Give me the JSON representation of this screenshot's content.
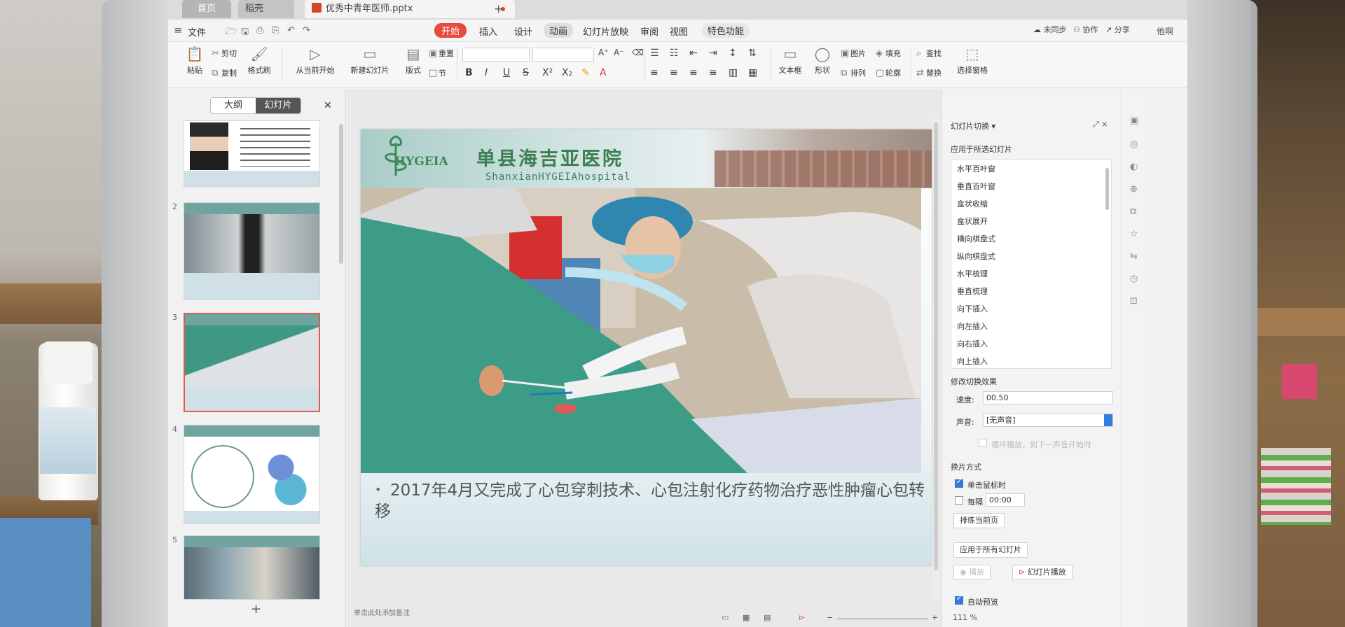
{
  "tabs": {
    "home": "首页",
    "shell": "稻壳",
    "file": "优秀中青年医师.pptx"
  },
  "menu": {
    "file": "文件",
    "items": [
      "开始",
      "插入",
      "设计",
      "动画",
      "幻灯片放映",
      "审阅",
      "视图",
      "特色功能"
    ],
    "user": "他啊"
  },
  "ribbon": {
    "paste": "粘贴",
    "cut": "剪切",
    "copy": "复制",
    "format_painter": "格式刷",
    "from_current": "从当前开始",
    "new_slide": "新建幻灯片",
    "layout": "版式",
    "reset": "重置",
    "section": "节",
    "text_box": "文本框",
    "shape": "形状",
    "picture": "图片",
    "arrange": "排列",
    "fill": "填充",
    "outline": "轮廓",
    "find": "查找",
    "replace": "替换",
    "select_pane": "选择窗格",
    "not_synced": "未同步",
    "collaborate": "协作",
    "share": "分享"
  },
  "leftpane": {
    "outline_tab": "大纲",
    "slides_tab": "幻灯片",
    "slide_numbers": [
      "2",
      "3",
      "4",
      "5"
    ]
  },
  "slide": {
    "hospital_name": "单县海吉亚医院",
    "hospital_en": "ShanxianHYGEIAhospital",
    "logo": "HYGEIA",
    "bullet": "2017年4月又完成了心包穿刺技术、心包注射化疗药物治疗恶性肿瘤心包转移"
  },
  "editor": {
    "notes_placeholder": "单击此处添加备注"
  },
  "transition": {
    "title": "幻灯片切换",
    "apply_label": "应用于所选幻灯片",
    "effects": [
      "水平百叶窗",
      "垂直百叶窗",
      "盒状收缩",
      "盒状展开",
      "横向棋盘式",
      "纵向棋盘式",
      "水平梳理",
      "垂直梳理",
      "向下插入",
      "向左插入",
      "向右插入",
      "向上插入"
    ],
    "modify_label": "修改切换效果",
    "speed_label": "速度:",
    "speed_value": "00.50",
    "sound_label": "声音:",
    "sound_value": "[无声音]",
    "loop_label": "循环播放，到下一声音开始时",
    "advance_label": "换片方式",
    "on_click": "单击鼠标时",
    "every_label": "每隔",
    "every_value": "00:00",
    "rehearse": "排练当前页",
    "apply_all": "应用于所有幻灯片",
    "play": "播放",
    "slideshow": "幻灯片播放",
    "auto_preview": "自动预览"
  },
  "status": {
    "zoom": "111 %"
  }
}
